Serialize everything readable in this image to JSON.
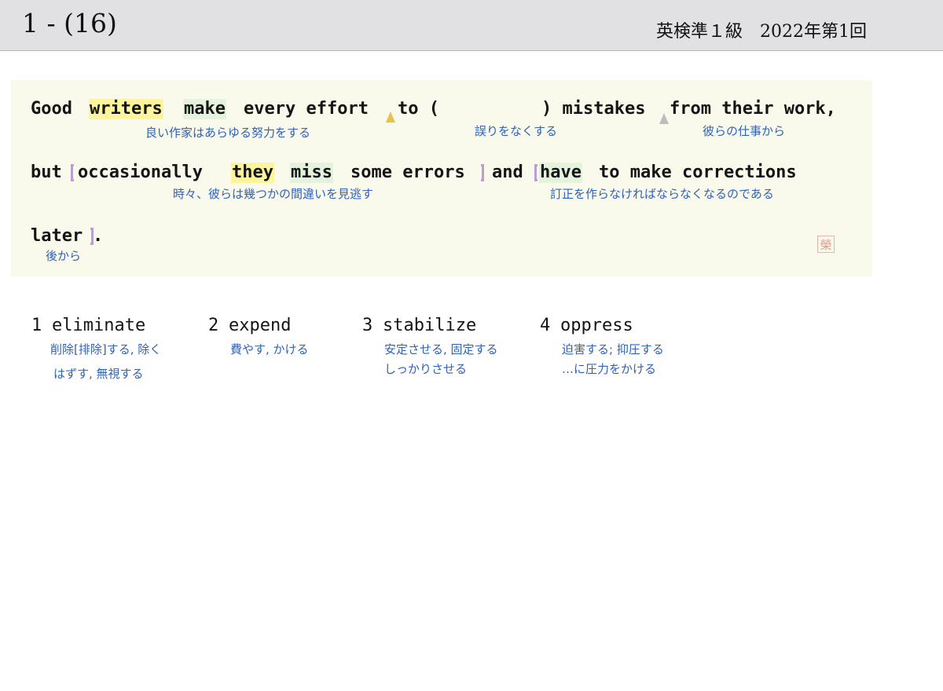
{
  "header": {
    "question_number": "1 - (16)",
    "exam_title": "英検準１級　2022年第1回"
  },
  "passage": {
    "words": {
      "good": "Good",
      "writers": "writers",
      "make": "make",
      "every_effort": "every effort",
      "to": "to (",
      "blank_close": ") mistakes",
      "from_their_work": "from their work,",
      "but": "but",
      "occasionally": "occasionally",
      "they": "they",
      "miss": "miss",
      "some_errors": "some errors",
      "and": "and",
      "have": "have",
      "to_make_corrections": "to make corrections",
      "later": "later",
      "period": "."
    },
    "glosses": {
      "g1": "良い作家はあらゆる努力をする",
      "g2": "誤りをなくする",
      "g3": "彼らの仕事から",
      "g4": "時々、彼らは幾つかの間違いを見逃す",
      "g5": "訂正を作らなければならなくなるのである",
      "g6": "後から"
    },
    "seal": "榮"
  },
  "choices": [
    {
      "num": "1",
      "word": "eliminate",
      "meanings": [
        "削除[排除]する, 除く",
        "はずす, 無視する"
      ]
    },
    {
      "num": "2",
      "word": "expend",
      "meanings": [
        "費やす, かける"
      ]
    },
    {
      "num": "3",
      "word": "stabilize",
      "meanings": [
        "安定させる, 固定する",
        "しっかりさせる"
      ]
    },
    {
      "num": "4",
      "word": "oppress",
      "meanings": [
        "迫害する; 抑圧する",
        "…に圧力をかける"
      ]
    }
  ]
}
